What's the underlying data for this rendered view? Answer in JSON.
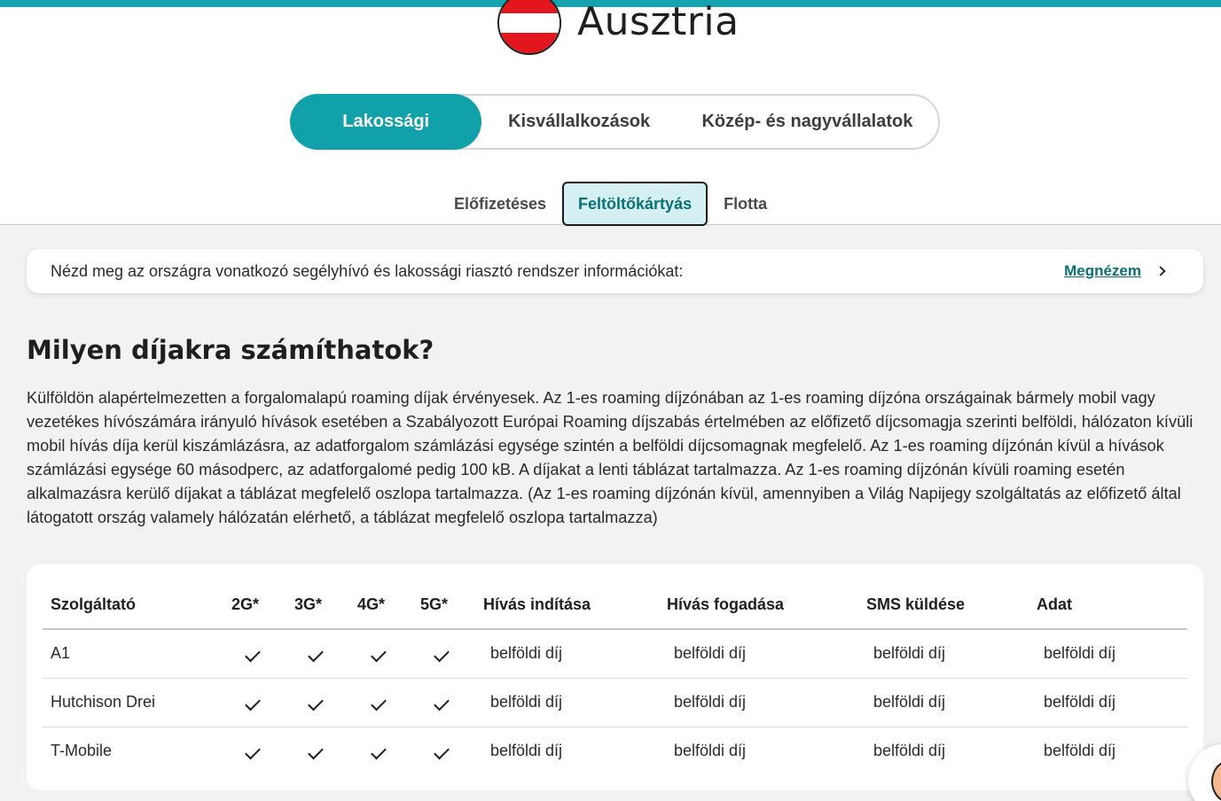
{
  "country": {
    "name": "Ausztria",
    "flag_colors": [
      "#e4161d",
      "#ffffff",
      "#e4161d"
    ]
  },
  "segments": [
    {
      "label": "Lakossági",
      "active": true
    },
    {
      "label": "Kisvállalkozások",
      "active": false
    },
    {
      "label": "Közép- és nagyvállalatok",
      "active": false
    }
  ],
  "subtabs": [
    {
      "label": "Előfizetéses",
      "active": false
    },
    {
      "label": "Feltöltőkártyás",
      "active": true
    },
    {
      "label": "Flotta",
      "active": false
    }
  ],
  "info": {
    "text": "Nézd meg az országra vonatkozó segélyhívó és lakossági riasztó rendszer információkat:",
    "link": "Megnézem"
  },
  "section": {
    "heading": "Milyen díjakra számíthatok?",
    "paragraph": "Külföldön alapértelmezetten a forgalomalapú roaming díjak érvényesek. Az 1-es roaming díjzónában az 1-es roaming díjzóna országainak bármely mobil vagy vezetékes hívószámára irányuló hívások esetében a Szabályozott Európai Roaming díjszabás értelmében az előfizető díjcsomagja szerinti belföldi, hálózaton kívüli mobil hívás díja kerül kiszámlázásra, az adatforgalom számlázási egysége szintén a belföldi díjcsomagnak megfelelő. Az 1-es roaming díjzónán kívül a hívások számlázási egysége 60 másodperc, az adatforgalomé pedig 100 kB. A díjakat a lenti táblázat tartalmazza. Az 1-es roaming díjzónán kívüli roaming esetén alkalmazásra kerülő díjakat a táblázat megfelelő oszlopa tartalmazza. (Az 1-es roaming díjzónán kívül, amennyiben a Világ Napijegy szolgáltatás az előfizető által látogatott ország valamely hálózatán elérhető, a táblázat megfelelő oszlopa tartalmazza)"
  },
  "table": {
    "headers": [
      "Szolgáltató",
      "2G*",
      "3G*",
      "4G*",
      "5G*",
      "Hívás indítása",
      "Hívás fogadása",
      "SMS küldése",
      "Adat"
    ],
    "rows": [
      {
        "provider": "A1",
        "call_out": "belföldi díj",
        "call_in": "belföldi díj",
        "sms": "belföldi díj",
        "data": "belföldi díj"
      },
      {
        "provider": "Hutchison Drei",
        "call_out": "belföldi díj",
        "call_in": "belföldi díj",
        "sms": "belföldi díj",
        "data": "belföldi díj"
      },
      {
        "provider": "T-Mobile",
        "call_out": "belföldi díj",
        "call_in": "belföldi díj",
        "sms": "belföldi díj",
        "data": "belföldi díj"
      }
    ]
  },
  "colors": {
    "accent": "#11a1ab",
    "link": "#0b6f77",
    "active_subtab_bg": "#d4f0f2"
  }
}
